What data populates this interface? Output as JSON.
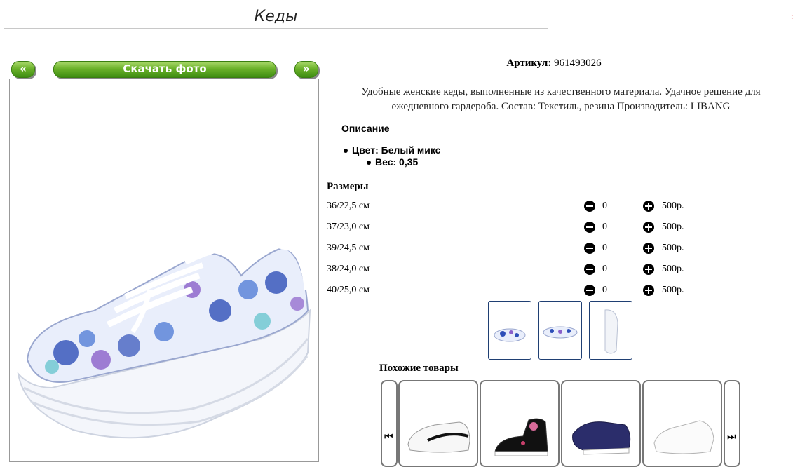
{
  "page": {
    "title": "Кеды"
  },
  "gallery": {
    "prev_label": "«",
    "download_label": "Скачать фото",
    "next_label": "»"
  },
  "product": {
    "article_label": "Артикул:",
    "article_value": "961493026",
    "description": "Удобные женские кеды, выполненные из качественного материала. Удачное решение для ежедневного гардероба. Состав: Текстиль, резина Производитель: LIBANG",
    "description_heading": "Описание",
    "attributes": [
      {
        "text": "Цвет: Белый микс"
      },
      {
        "text": "Вес: 0,35"
      }
    ]
  },
  "sizes": {
    "heading": "Размеры",
    "rows": [
      {
        "label": "36/22,5 см",
        "qty": "0",
        "price": "500р."
      },
      {
        "label": "37/23,0 см",
        "qty": "0",
        "price": "500р."
      },
      {
        "label": "39/24,5 см",
        "qty": "0",
        "price": "500р."
      },
      {
        "label": "38/24,0 см",
        "qty": "0",
        "price": "500р."
      },
      {
        "label": "40/25,0 см",
        "qty": "0",
        "price": "500р."
      }
    ]
  },
  "similar": {
    "heading": "Похожие товары"
  },
  "colors": {
    "button_green": "#6bb22a",
    "thumb_border": "#1f3f73",
    "floral_blue": "#2e4fb8",
    "floral_purple": "#8a5fc9"
  }
}
